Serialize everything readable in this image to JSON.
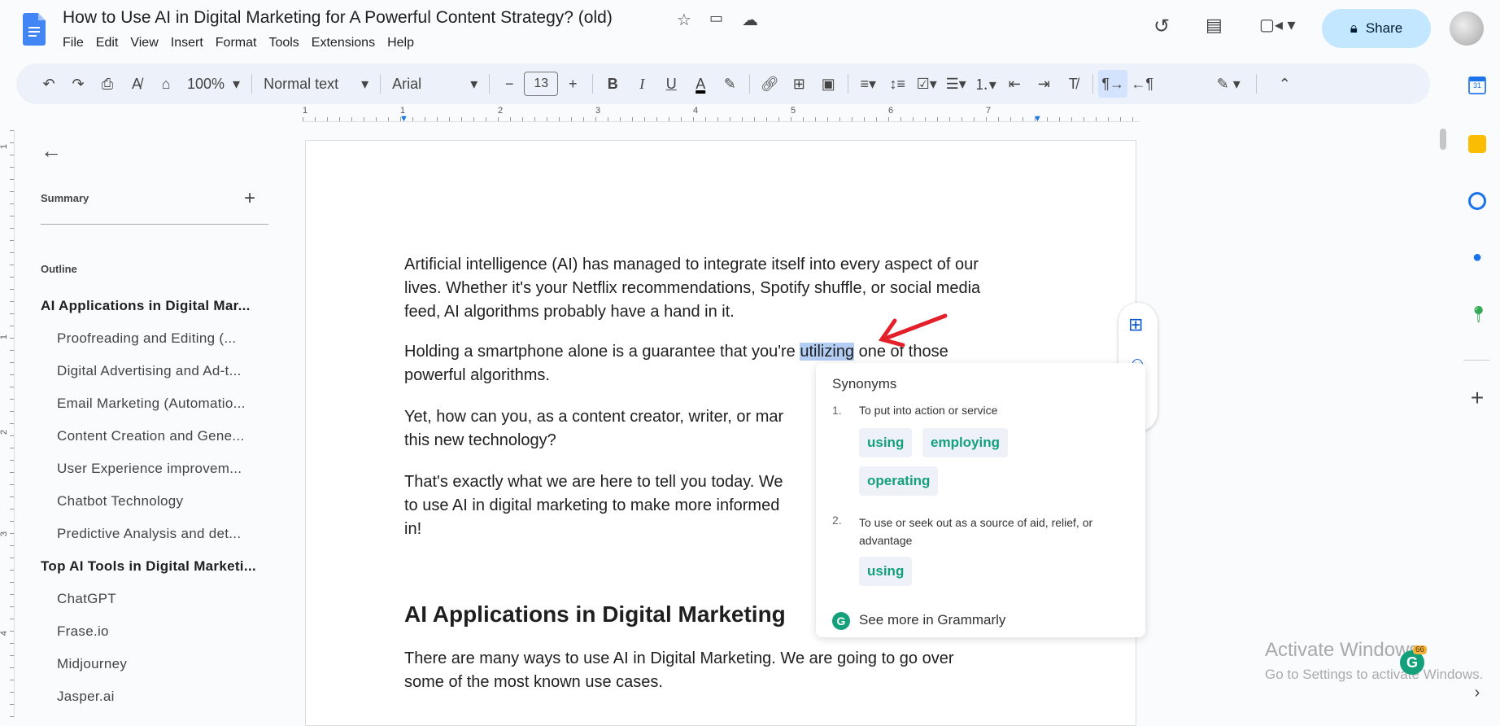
{
  "title": "How to Use AI in Digital Marketing for A Powerful Content Strategy? (old)",
  "menu": [
    "File",
    "Edit",
    "View",
    "Insert",
    "Format",
    "Tools",
    "Extensions",
    "Help"
  ],
  "share_label": "Share",
  "toolbar": {
    "zoom": "100%",
    "style": "Normal text",
    "font": "Arial",
    "font_size": "13",
    "minus": "−",
    "plus": "+"
  },
  "ruler": [
    "1",
    "1",
    "2",
    "3",
    "4",
    "5",
    "6",
    "7"
  ],
  "vruler": [
    "1",
    "1",
    "2",
    "3",
    "4"
  ],
  "sidebar": {
    "summary": "Summary",
    "outline": "Outline",
    "items": [
      {
        "label": "AI Applications in Digital Mar...",
        "level": "h"
      },
      {
        "label": "Proofreading and Editing (...",
        "level": "s"
      },
      {
        "label": "Digital Advertising and Ad-t...",
        "level": "s"
      },
      {
        "label": "Email Marketing (Automatio...",
        "level": "s"
      },
      {
        "label": "Content Creation and Gene...",
        "level": "s"
      },
      {
        "label": "User Experience improvem...",
        "level": "s"
      },
      {
        "label": "Chatbot Technology",
        "level": "s"
      },
      {
        "label": "Predictive Analysis and det...",
        "level": "s"
      },
      {
        "label": "Top AI Tools in Digital Marketi...",
        "level": "h"
      },
      {
        "label": "ChatGPT",
        "level": "s"
      },
      {
        "label": "Frase.io",
        "level": "s"
      },
      {
        "label": "Midjourney",
        "level": "s"
      },
      {
        "label": "Jasper.ai",
        "level": "s"
      }
    ]
  },
  "doc": {
    "p1": [
      "Artificial intelligence (AI) has managed to integrate itself into every aspect of our",
      "lives. Whether it's your Netflix recommendations, Spotify shuffle, or social media",
      "feed, AI algorithms probably have a hand in it."
    ],
    "p2a": "Holding a smartphone alone is a guarantee that you're ",
    "p2sel": "utilizing",
    "p2b": " one of those",
    "p2c": "powerful algorithms.",
    "p3": [
      "Yet, how can you, as a content creator, writer, or mar",
      "this new technology?"
    ],
    "p4": [
      "That's exactly what we are here to tell you today. We",
      "to use AI in digital marketing to make more informed",
      "in!"
    ],
    "heading": "AI Applications in Digital Marketing",
    "p5": [
      "There are many ways to use AI in Digital Marketing. We are going to go over",
      "some of the most known use cases."
    ]
  },
  "popup": {
    "title": "Synonyms",
    "defs": [
      {
        "num": "1.",
        "text": "To put into action or service",
        "chips": [
          "using",
          "employing",
          "operating"
        ]
      },
      {
        "num": "2.",
        "text": "To use or seek out as a source of aid, relief, or",
        "text2": "advantage",
        "chips": [
          "using"
        ]
      }
    ],
    "footer": "See more in Grammarly"
  },
  "grammarly_badge": "66",
  "watermark": {
    "line1": "Activate Windows",
    "line2": "Go to Settings to activate Windows."
  },
  "colors": {
    "accent": "#0b57d0",
    "grammarly": "#13a07b",
    "share_bg": "#c2e7ff"
  }
}
